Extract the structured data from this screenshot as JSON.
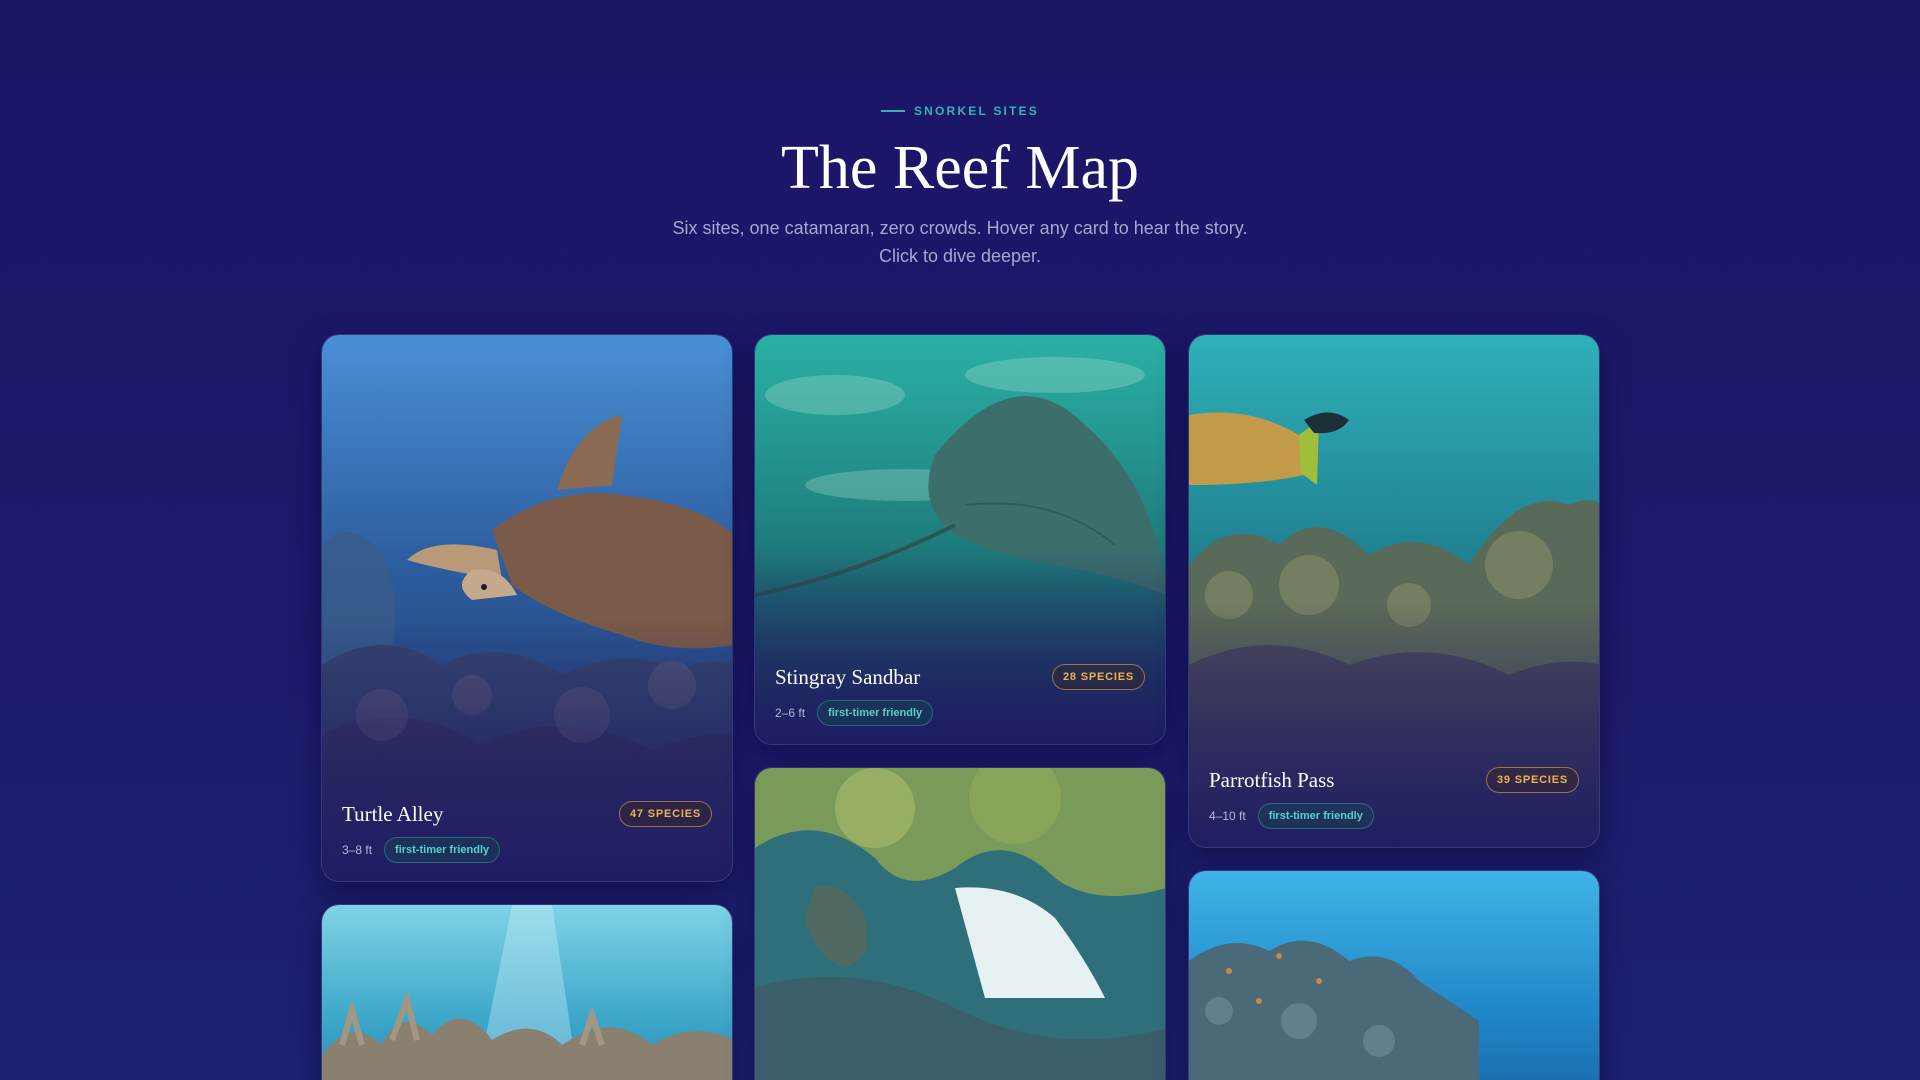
{
  "header": {
    "eyebrow": "SNORKEL SITES",
    "title": "The Reef Map",
    "subtitle_line1": "Six sites, one catamaran, zero crowds. Hover any card to hear the story.",
    "subtitle_line2": "Click to dive deeper."
  },
  "cards": [
    {
      "name": "Turtle Alley",
      "species": "47 SPECIES",
      "depth": "3–8 ft",
      "tag": "first-timer friendly"
    },
    {
      "name": "Stingray Sandbar",
      "species": "28 SPECIES",
      "depth": "2–6 ft",
      "tag": "first-timer friendly"
    },
    {
      "name": "Parrotfish Pass",
      "species": "39 SPECIES",
      "depth": "4–10 ft",
      "tag": "first-timer friendly"
    }
  ],
  "colors": {
    "background": "#1b1566",
    "accent_teal": "#35b3b3",
    "species_amber": "#f0b054",
    "tag_teal": "#58d0c7"
  }
}
